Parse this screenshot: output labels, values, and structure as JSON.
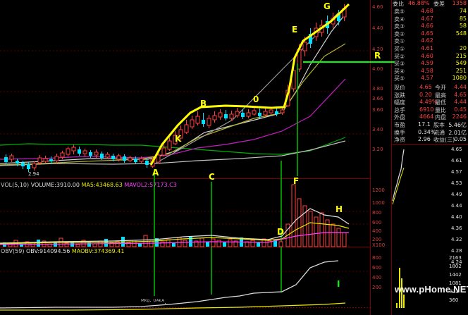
{
  "colors": {
    "up": "#ff4040",
    "down": "#00e0ff",
    "white": "#e8e8e8",
    "yellow": "#ffff00",
    "magenta": "#ff40ff",
    "green": "#00cc00",
    "grid": "#7a0000",
    "orderbook_label": "#c8c8c8"
  },
  "annotations": {
    "A": "A",
    "B": "B",
    "C": "C",
    "D": "D",
    "E": "E",
    "F": "F",
    "G": "G",
    "H": "H",
    "I": "I",
    "K": "K",
    "R": "R",
    "zero": "0"
  },
  "volume_header": {
    "name": "VOL(5,10)",
    "volume": "VOLUME:3910.00",
    "ma5": "MA5:43468.63",
    "mavol2": "MAVOL2:57173.C3"
  },
  "obv_header": {
    "name": "OBV(59)",
    "obv": "OBV:914094.56",
    "maobv": "MAOBV:374369.41"
  },
  "low_label": "2.94",
  "price_axis": [
    "4.60",
    "4.40",
    "4.20",
    "4.00",
    "3.80",
    "3.66",
    "3.60",
    "3.40",
    "3.20"
  ],
  "volume_axis": [
    "1200",
    "1000",
    "800",
    "600",
    "400",
    "200",
    "X100"
  ],
  "obv_axis": [
    "800",
    "600",
    "400",
    "200"
  ],
  "orderbook": {
    "header": {
      "label": "委比",
      "ratio": "46.88%",
      "diff_label": "委差",
      "diff": "1358"
    },
    "asks": [
      {
        "label": "卖⑤",
        "price": "4.68",
        "vol": "74"
      },
      {
        "label": "卖④",
        "price": "4.67",
        "vol": "85"
      },
      {
        "label": "卖③",
        "price": "4.66",
        "vol": "58"
      },
      {
        "label": "卖②",
        "price": "4.65",
        "vol": "548"
      },
      {
        "label": "卖①",
        "price": "4.62",
        "vol": ""
      }
    ],
    "bids": [
      {
        "label": "买①",
        "price": "4.61",
        "vol": "20"
      },
      {
        "label": "买②",
        "price": "4.60",
        "vol": "215"
      },
      {
        "label": "买③",
        "price": "4.59",
        "vol": "549"
      },
      {
        "label": "买④",
        "price": "4.58",
        "vol": "251"
      },
      {
        "label": "买⑤",
        "price": "4.57",
        "vol": "1080"
      }
    ],
    "stats": [
      {
        "l1": "现价",
        "v1": "4.65",
        "l2": "今开",
        "v2": "4.44"
      },
      {
        "l1": "涨跌",
        "v1": "0.20",
        "l2": "最高",
        "v2": "4.65"
      },
      {
        "l1": "幅度",
        "v1": "4.49%",
        "l2": "最低",
        "v2": "4.44"
      },
      {
        "l1": "总手",
        "v1": "6910",
        "l2": "量比",
        "v2": "0.45"
      },
      {
        "l1": "外盘",
        "v1": "4664",
        "l2": "内盘",
        "v2": "2246"
      }
    ],
    "stats2": [
      {
        "l1": "市盈",
        "v1": "17.1",
        "l2": "股本",
        "v2": "5.46亿"
      },
      {
        "l1": "换手",
        "v1": "0.34%",
        "l2": "流通",
        "v2": "2.01亿"
      },
      {
        "l1": "净资",
        "v1": "2.96",
        "l2": "收益(三)",
        "v2": "0.05"
      }
    ]
  },
  "mini_price_axis": [
    "4.65",
    "4.61",
    "4.57",
    "4.53",
    "4.49",
    "4.44",
    "4.40",
    "4.36",
    "4.32",
    "4.28",
    "4.24"
  ],
  "mini_vol_axis": [
    "2163",
    "1802",
    "1442",
    "1081",
    "721",
    "360"
  ],
  "watermark": "www.pHome.NET",
  "footer_text": "ᴹᴷᵍᐧ ᵁᴬᵏᴬ."
}
